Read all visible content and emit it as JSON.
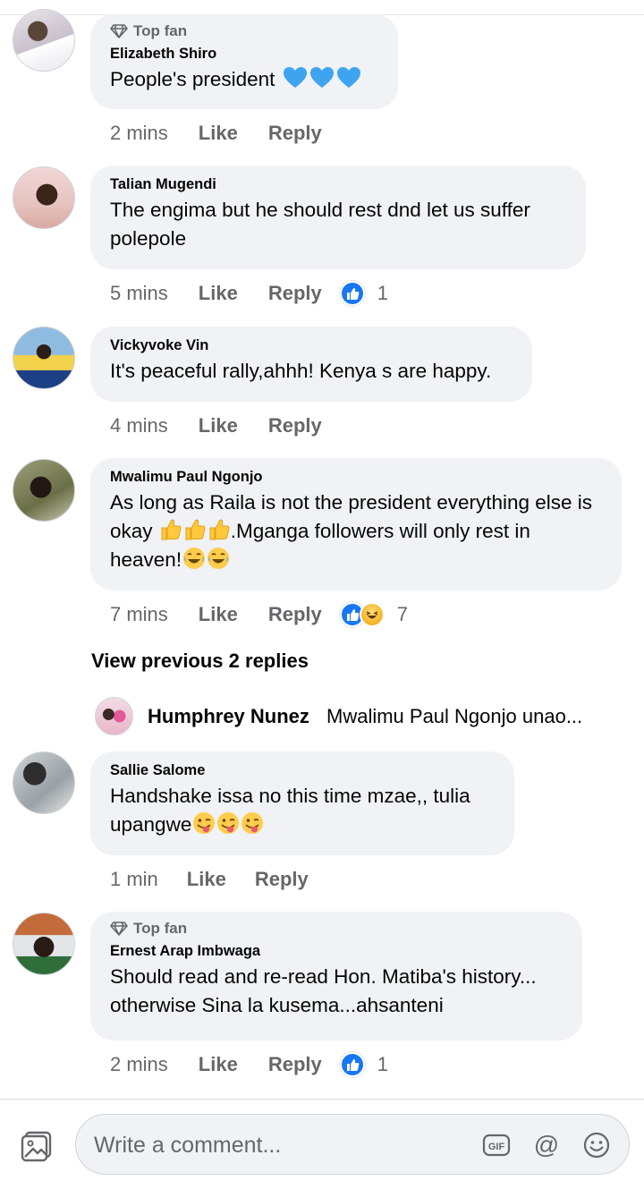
{
  "comments": [
    {
      "top_fan": "Top fan",
      "author": "Elizabeth Shiro",
      "text": "People's president",
      "time": "2 mins",
      "like": "Like",
      "reply": "Reply"
    },
    {
      "author": "Talian Mugendi",
      "text": "The engima but he should  rest dnd let us suffer polepole",
      "time": "5 mins",
      "like": "Like",
      "reply": "Reply",
      "reactions": {
        "types": [
          "like"
        ],
        "count": "1"
      }
    },
    {
      "author": "Vickyvoke Vin",
      "text": "It's peaceful rally,ahhh! Kenya s are happy.",
      "time": "4 mins",
      "like": "Like",
      "reply": "Reply"
    },
    {
      "author": "Mwalimu Paul Ngonjo",
      "text_a": "As long as Raila is not the president everything else is okay ",
      "text_b": ".Mganga followers will only rest in heaven!",
      "time": "7 mins",
      "like": "Like",
      "reply": "Reply",
      "reactions": {
        "types": [
          "like",
          "haha"
        ],
        "count": "7"
      }
    },
    {
      "author": "Sallie Salome",
      "text": "Handshake issa no this time mzae,, tulia upangwe",
      "time": "1 min",
      "like": "Like",
      "reply": "Reply"
    },
    {
      "top_fan": "Top fan",
      "author": "Ernest Arap Imbwaga",
      "text": "Should read and re-read Hon. Matiba's history... otherwise Sina la kusema...ahsanteni",
      "time": "2 mins",
      "like": "Like",
      "reply": "Reply",
      "reactions": {
        "types": [
          "like"
        ],
        "count": "1"
      }
    }
  ],
  "view_previous": "View previous 2 replies",
  "reply_preview": {
    "author": "Humphrey Nunez",
    "text": "Mwalimu Paul Ngonjo unao..."
  },
  "composer": {
    "placeholder": "Write a comment...",
    "gif_label": "GIF",
    "at_symbol": "@"
  },
  "icons": [
    "diamond-icon",
    "heart-emoji",
    "thumbs-up-emoji",
    "joy-emoji",
    "winking-tongue-emoji",
    "like-reaction-icon",
    "haha-reaction-icon",
    "photo-icon",
    "gif-icon",
    "mention-icon",
    "smiley-icon"
  ],
  "colors": {
    "bubble": "#f0f2f5",
    "secondary_text": "#65676b",
    "like_blue": "#1877f2",
    "heart_blue": "#3ea4f0"
  }
}
